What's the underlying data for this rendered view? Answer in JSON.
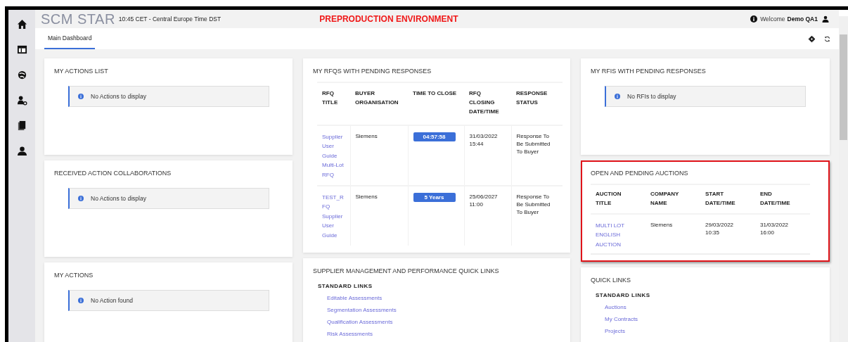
{
  "header": {
    "logo": "SCM STAR",
    "time": "10:45 CET - Central Europe Time DST",
    "environment": "PREPRODUCTION ENVIRONMENT",
    "welcome": "Welcome",
    "user": "Demo QA1"
  },
  "tabs": [
    {
      "label": "Main Dashboard",
      "selected": true
    }
  ],
  "columns": [
    [
      {
        "kind": "message",
        "title": "MY ACTIONS LIST",
        "message": "No Actions to display",
        "highlighted": false
      },
      {
        "kind": "message",
        "title": "RECEIVED ACTION COLLABORATIONS",
        "message": "No Actions to display",
        "highlighted": false
      },
      {
        "kind": "message",
        "title": "MY ACTIONS",
        "message": "No Action found",
        "highlighted": false
      }
    ],
    [
      {
        "kind": "table",
        "title": "MY RFQS WITH PENDING RESPONSES",
        "highlighted": false,
        "columns": [
          {
            "label": "RFQ TITLE",
            "kind": "link"
          },
          {
            "label": "BUYER ORGANISATION",
            "kind": "text"
          },
          {
            "label": "TIME TO CLOSE",
            "kind": "badge"
          },
          {
            "label": "RFQ CLOSING DATE/TIME",
            "kind": "text"
          },
          {
            "label": "RESPONSE STATUS",
            "kind": "text"
          }
        ],
        "rows": [
          [
            "Supplier User Guide Multi-Lot RFQ",
            "Siemens",
            "04:57:58",
            "31/03/2022 15:44",
            "Response To Be Submitted To Buyer"
          ],
          [
            "TEST_RFQ Supplier User Guide",
            "Siemens",
            "5 Years",
            "25/06/2027 11:00",
            "Response To Be Submitted To Buyer"
          ]
        ]
      },
      {
        "kind": "links",
        "title": "SUPPLIER MANAGEMENT AND PERFORMANCE QUICK LINKS",
        "highlighted": false,
        "section": "STANDARD LINKS",
        "links": [
          "Editable Assessments",
          "Segmentation Assessments",
          "Qualification Assessments",
          "Risk Assessments"
        ]
      }
    ],
    [
      {
        "kind": "message",
        "title": "MY RFIS WITH PENDING RESPONSES",
        "message": "No RFIs to display",
        "highlighted": false
      },
      {
        "kind": "table",
        "title": "OPEN AND PENDING AUCTIONS",
        "highlighted": true,
        "columns": [
          {
            "label": "AUCTION TITLE",
            "kind": "link"
          },
          {
            "label": "COMPANY NAME",
            "kind": "text"
          },
          {
            "label": "START DATE/TIME",
            "kind": "text"
          },
          {
            "label": "END DATE/TIME",
            "kind": "text"
          }
        ],
        "rows": [
          [
            "MULTI LOT ENGLISH AUCTION",
            "Siemens",
            "29/03/2022 10:35",
            "31/03/2022 16:00"
          ]
        ]
      },
      {
        "kind": "links",
        "title": "QUICK LINKS",
        "highlighted": false,
        "section": "STANDARD LINKS",
        "links": [
          "Auctions",
          "My Contracts",
          "Projects"
        ]
      }
    ]
  ]
}
